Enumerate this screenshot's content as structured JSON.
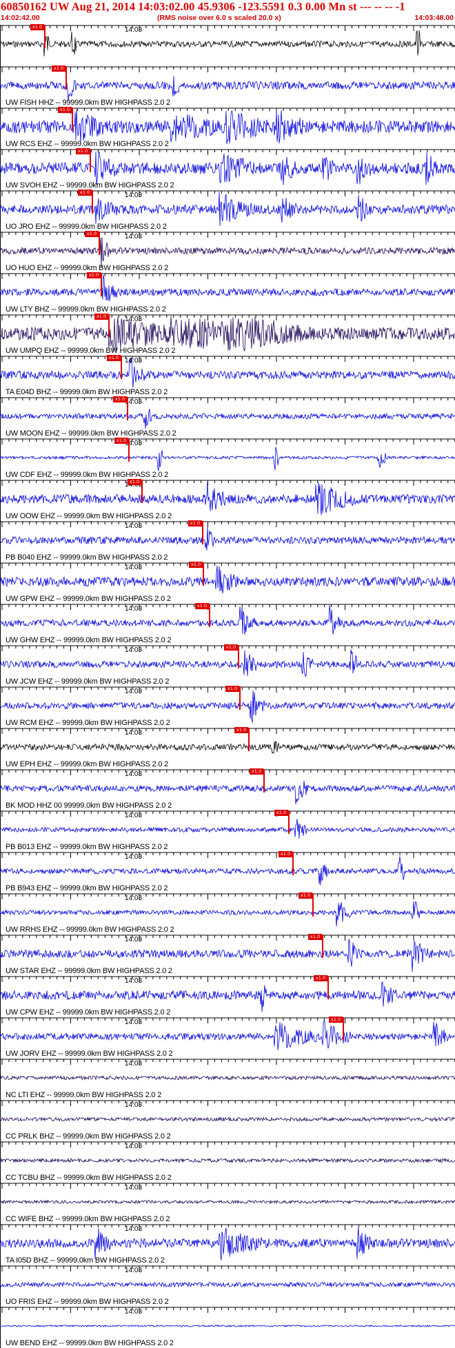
{
  "header": {
    "title": "60850162 UW Aug 21, 2014 14:03:02.00   45.9306 -123.5591  0.3 0.00 Mn st --- -- --   -1",
    "start_time": "14:02:42.00",
    "rms_note": "(RMS noise over 6.0 s scaled 20.0 x)",
    "end_time": "14:03:48.00"
  },
  "colors": {
    "header_red": "#e00000",
    "trace_blue": "#0000dd",
    "trace_dark": "#1a0055",
    "trace_black": "#000000",
    "pick_red": "#e00000"
  },
  "traces": [
    {
      "minute_label": "14:03",
      "station": "",
      "pick_label": "x1.0",
      "color": "black",
      "amp": 0.18
    },
    {
      "minute_label": "",
      "station": "UW FISH HHZ -- 99999.0km BW  HIGHPASS  2.0  2",
      "pick_label": "x1.0",
      "color": "blue",
      "amp": 0.25
    },
    {
      "minute_label": "",
      "station": "UW RCS EHZ -- 99999.0km BW  HIGHPASS  2.0  2",
      "pick_label": "x1.0",
      "color": "blue",
      "amp": 0.45
    },
    {
      "minute_label": "",
      "station": "UW SVOH EHZ -- 99999.0km BW  HIGHPASS  2.0  2",
      "pick_label": "x1.0",
      "color": "blue",
      "amp": 0.4
    },
    {
      "minute_label": "14:03",
      "station": "UO JRO EHZ -- 99999.0km BW  HIGHPASS  2.0  2",
      "pick_label": "x1.0",
      "color": "blue",
      "amp": 0.3
    },
    {
      "minute_label": "14:03",
      "station": "UO HUO EHZ -- 99999.0km BW  HIGHPASS  2.0  2",
      "pick_label": "x1.0",
      "color": "dark",
      "amp": 0.2
    },
    {
      "minute_label": "",
      "station": "UW LTY BHZ -- 99999.0km BW  HIGHPASS  2.0  2",
      "pick_label": "x1.0",
      "color": "blue",
      "amp": 0.22
    },
    {
      "minute_label": "14:03",
      "station": "UW UMPQ EHZ -- 99999.0km BW  HIGHPASS  2.0  2",
      "pick_label": "x1.0",
      "color": "dark",
      "amp": 0.45
    },
    {
      "minute_label": "14:03",
      "station": "TA E04D BHZ -- 99999.0km BW  HIGHPASS  2.0  2",
      "pick_label": "x1.0",
      "color": "blue",
      "amp": 0.25
    },
    {
      "minute_label": "14:03",
      "station": "UW MOON EHZ -- 99999.0km BW  HIGHPASS  2.0  2",
      "pick_label": "x1.0",
      "color": "blue",
      "amp": 0.15
    },
    {
      "minute_label": "14:03",
      "station": "UW CDF EHZ -- 99999.0km BW  HIGHPASS  2.0  2",
      "pick_label": "x1.0",
      "color": "blue",
      "amp": 0.05
    },
    {
      "minute_label": "14:03",
      "station": "UW OOW EHZ -- 99999.0km BW  HIGHPASS  2.0  2",
      "pick_label": "x1.0",
      "color": "blue",
      "amp": 0.3
    },
    {
      "minute_label": "14:03",
      "station": "PB B040 EHZ -- 99999.0km BW  HIGHPASS  2.0  2",
      "pick_label": "x1.0",
      "color": "blue",
      "amp": 0.22
    },
    {
      "minute_label": "14:03",
      "station": "UW GPW EHZ -- 99999.0km BW  HIGHPASS  2.0  2",
      "pick_label": "x1.0",
      "color": "blue",
      "amp": 0.3
    },
    {
      "minute_label": "14:03",
      "station": "UW GHW EHZ -- 99999.0km BW  HIGHPASS  2.0  2",
      "pick_label": "x1.0",
      "color": "blue",
      "amp": 0.2
    },
    {
      "minute_label": "14:03",
      "station": "UW JCW EHZ -- 99999.0km BW  HIGHPASS  2.0  2",
      "pick_label": "x1.0",
      "color": "blue",
      "amp": 0.2
    },
    {
      "minute_label": "14:03",
      "station": "UW RCM EHZ -- 99999.0km BW  HIGHPASS  2.0  2",
      "pick_label": "x1.0",
      "color": "blue",
      "amp": 0.2
    },
    {
      "minute_label": "14:03",
      "station": "UW EPH EHZ -- 99999.0km BW  HIGHPASS  2.0  2",
      "pick_label": "x1.0",
      "color": "black",
      "amp": 0.18
    },
    {
      "minute_label": "14:03",
      "station": "BK MOD HHZ 00 99999.0km BW  HIGHPASS  2.0  2",
      "pick_label": "x1.0",
      "color": "blue",
      "amp": 0.18
    },
    {
      "minute_label": "14:03",
      "station": "PB B013 EHZ -- 99999.0km BW  HIGHPASS  2.0  2",
      "pick_label": "x1.0",
      "color": "blue",
      "amp": 0.12
    },
    {
      "minute_label": "14:03",
      "station": "PB B943 EHZ -- 99999.0km BW  HIGHPASS  2.0  2",
      "pick_label": "x1.0",
      "color": "blue",
      "amp": 0.15
    },
    {
      "minute_label": "14:03",
      "station": "UW RRHS EHZ -- 99999.0km BW  HIGHPASS  2.0  2",
      "pick_label": "x1.0",
      "color": "blue",
      "amp": 0.12
    },
    {
      "minute_label": "14:03",
      "station": "UW STAR EHZ -- 99999.0km BW  HIGHPASS  2.0  2",
      "pick_label": "x1.0",
      "color": "blue",
      "amp": 0.25
    },
    {
      "minute_label": "14:03",
      "station": "UW CPW EHZ -- 99999.0km BW  HIGHPASS  2.0  2",
      "pick_label": "x1.0",
      "color": "blue",
      "amp": 0.3
    },
    {
      "minute_label": "14:03",
      "station": "UW JORV EHZ -- 99999.0km BW  HIGHPASS  2.0  2",
      "pick_label": "x1.0",
      "color": "blue",
      "amp": 0.2
    },
    {
      "minute_label": "14:03",
      "station": "NC LTI EHZ -- 99999.0km BW  HIGHPASS  2.0  2",
      "pick_label": "",
      "color": "dark",
      "amp": 0.08
    },
    {
      "minute_label": "14:03",
      "station": "CC PRLK BHZ -- 99999.0km BW  HIGHPASS  2.0  2",
      "pick_label": "",
      "color": "dark",
      "amp": 0.08
    },
    {
      "minute_label": "14:03",
      "station": "CC TCBU BHZ -- 99999.0km BW  HIGHPASS  2.0  2",
      "pick_label": "",
      "color": "dark",
      "amp": 0.08
    },
    {
      "minute_label": "14:03",
      "station": "CC WIFE BHZ -- 99999.0km BW  HIGHPASS  2.0  2",
      "pick_label": "",
      "color": "dark",
      "amp": 0.06
    },
    {
      "minute_label": "14:03",
      "station": "TA I05D BHZ -- 99999.0km BW  HIGHPASS  2.0  2",
      "pick_label": "",
      "color": "blue",
      "amp": 0.3
    },
    {
      "minute_label": "14:03",
      "station": "UO FRIS EHZ -- 99999.0km BW  HIGHPASS  2.0  2",
      "pick_label": "",
      "color": "blue",
      "amp": 0.12
    },
    {
      "minute_label": "14:03",
      "station": "UW BEND EHZ -- 99999.0km BW  HIGHPASS  2.0  2",
      "pick_label": "",
      "color": "blue",
      "amp": 0.0
    }
  ]
}
